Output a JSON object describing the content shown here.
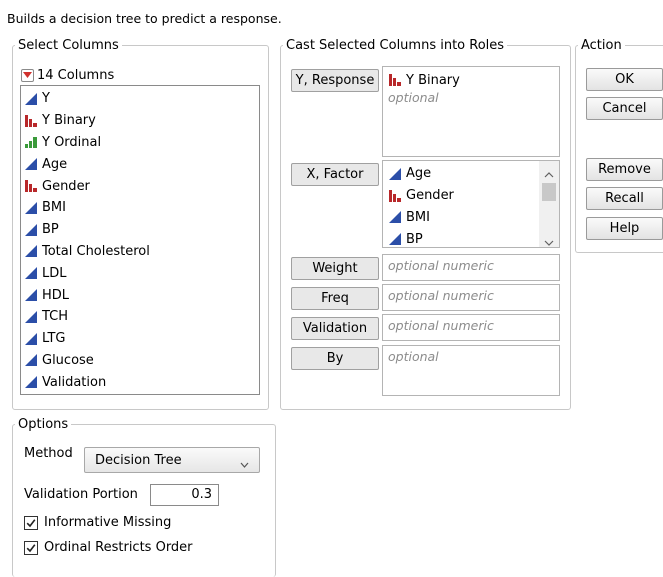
{
  "description": "Builds a decision tree to predict a response.",
  "select_columns": {
    "legend": "Select Columns",
    "count_label": "14 Columns",
    "items": [
      {
        "label": "Y",
        "type": "continuous"
      },
      {
        "label": "Y Binary",
        "type": "nominal"
      },
      {
        "label": "Y Ordinal",
        "type": "ordinal"
      },
      {
        "label": "Age",
        "type": "continuous"
      },
      {
        "label": "Gender",
        "type": "nominal"
      },
      {
        "label": "BMI",
        "type": "continuous"
      },
      {
        "label": "BP",
        "type": "continuous"
      },
      {
        "label": "Total Cholesterol",
        "type": "continuous"
      },
      {
        "label": "LDL",
        "type": "continuous"
      },
      {
        "label": "HDL",
        "type": "continuous"
      },
      {
        "label": "TCH",
        "type": "continuous"
      },
      {
        "label": "LTG",
        "type": "continuous"
      },
      {
        "label": "Glucose",
        "type": "continuous"
      },
      {
        "label": "Validation",
        "type": "continuous"
      }
    ]
  },
  "cast_roles": {
    "legend": "Cast Selected Columns into Roles",
    "y_response": {
      "button": "Y, Response",
      "value": "Y Binary",
      "value_type": "nominal",
      "placeholder": "optional"
    },
    "x_factor": {
      "button": "X, Factor",
      "items": [
        {
          "label": "Age",
          "type": "continuous"
        },
        {
          "label": "Gender",
          "type": "nominal"
        },
        {
          "label": "BMI",
          "type": "continuous"
        },
        {
          "label": "BP",
          "type": "continuous"
        }
      ]
    },
    "weight": {
      "button": "Weight",
      "placeholder": "optional numeric"
    },
    "freq": {
      "button": "Freq",
      "placeholder": "optional numeric"
    },
    "validation": {
      "button": "Validation",
      "placeholder": "optional numeric"
    },
    "by": {
      "button": "By",
      "placeholder": "optional"
    }
  },
  "action": {
    "legend": "Action",
    "ok": "OK",
    "cancel": "Cancel",
    "remove": "Remove",
    "recall": "Recall",
    "help": "Help"
  },
  "options": {
    "legend": "Options",
    "method_label": "Method",
    "method_value": "Decision Tree",
    "validation_portion_label": "Validation Portion",
    "validation_portion_value": "0.3",
    "informative_missing": {
      "label": "Informative Missing",
      "checked": true
    },
    "ordinal_restricts_order": {
      "label": "Ordinal Restricts Order",
      "checked": true
    }
  },
  "colors": {
    "continuous_icon": "#2b4ea8",
    "nominal_icon": "#b8282a",
    "ordinal_icon": "#3a9a3a",
    "dropdown_red": "#d0312d"
  }
}
